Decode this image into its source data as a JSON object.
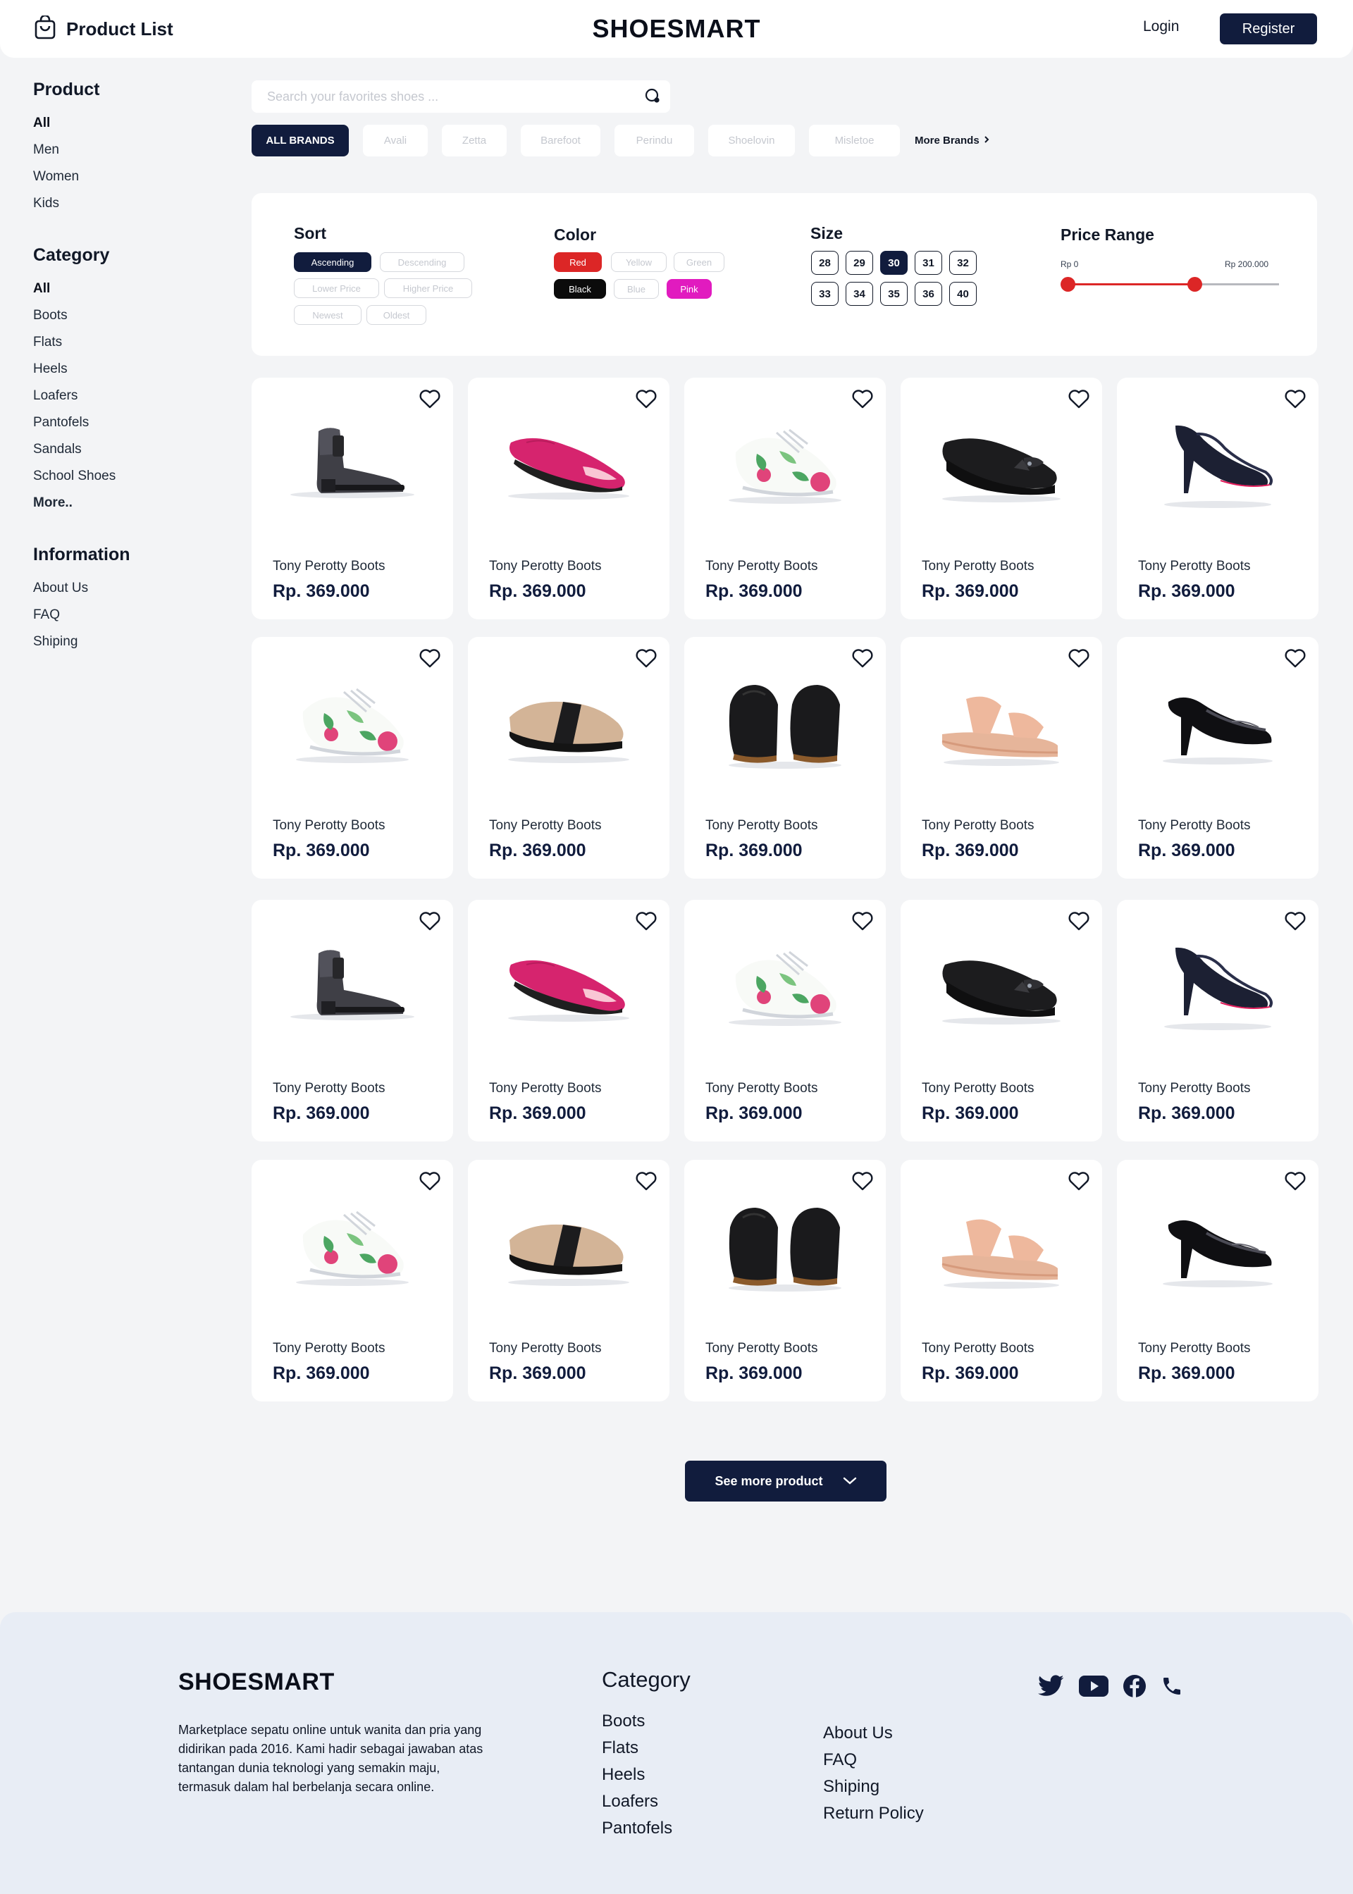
{
  "header": {
    "title": "Product List",
    "brand": "SHOESMART",
    "login_label": "Login",
    "register_label": "Register"
  },
  "sidebar": {
    "product": {
      "heading": "Product",
      "items": [
        "All",
        "Men",
        "Women",
        "Kids"
      ],
      "active": "All"
    },
    "category": {
      "heading": "Category",
      "items": [
        "All",
        "Boots",
        "Flats",
        "Heels",
        "Loafers",
        "Pantofels",
        "Sandals",
        "School Shoes"
      ],
      "more": "More..",
      "active": "All"
    },
    "information": {
      "heading": "Information",
      "items": [
        "About Us",
        "FAQ",
        "Shiping"
      ]
    }
  },
  "search": {
    "placeholder": "Search your favorites shoes ..."
  },
  "brands": {
    "items": [
      "ALL BRANDS",
      "Avali",
      "Zetta",
      "Barefoot",
      "Perindu",
      "Shoelovin",
      "Misletoe"
    ],
    "active": "ALL BRANDS",
    "more_label": "More Brands"
  },
  "filters": {
    "sort": {
      "title": "Sort",
      "options": [
        "Ascending",
        "Descending",
        "Lower Price",
        "Higher Price",
        "Newest",
        "Oldest"
      ],
      "selected": "Ascending"
    },
    "color": {
      "title": "Color",
      "options": [
        "Red",
        "Yellow",
        "Green",
        "Black",
        "Blue",
        "Pink"
      ],
      "selected": [
        "Red",
        "Black",
        "Pink"
      ],
      "swatches": {
        "Red": "#dc2626",
        "Black": "#0b0b0b",
        "Pink": "#e11bbf"
      }
    },
    "size": {
      "title": "Size",
      "options": [
        "28",
        "29",
        "30",
        "31",
        "32",
        "33",
        "34",
        "35",
        "36",
        "40"
      ],
      "selected": "30"
    },
    "price": {
      "title": "Price Range",
      "min_label": "Rp 0",
      "max_label": "Rp 200.000",
      "selected_fraction": [
        0.0,
        0.6
      ]
    }
  },
  "products": [
    {
      "name": "Tony Perotty Boots",
      "price": "Rp. 369.000",
      "shoe": "black-ankle-boot"
    },
    {
      "name": "Tony Perotty Boots",
      "price": "Rp. 369.000",
      "shoe": "pink-flat"
    },
    {
      "name": "Tony Perotty Boots",
      "price": "Rp. 369.000",
      "shoe": "floral-sneaker"
    },
    {
      "name": "Tony Perotty Boots",
      "price": "Rp. 369.000",
      "shoe": "black-wedge"
    },
    {
      "name": "Tony Perotty Boots",
      "price": "Rp. 369.000",
      "shoe": "navy-heel"
    },
    {
      "name": "Tony Perotty Boots",
      "price": "Rp. 369.000",
      "shoe": "floral-sneaker"
    },
    {
      "name": "Tony Perotty Boots",
      "price": "Rp. 369.000",
      "shoe": "beige-slipon"
    },
    {
      "name": "Tony Perotty Boots",
      "price": "Rp. 369.000",
      "shoe": "black-sandal"
    },
    {
      "name": "Tony Perotty Boots",
      "price": "Rp. 369.000",
      "shoe": "peach-wedge-sandal"
    },
    {
      "name": "Tony Perotty Boots",
      "price": "Rp. 369.000",
      "shoe": "black-patent-heel"
    },
    {
      "name": "Tony Perotty Boots",
      "price": "Rp. 369.000",
      "shoe": "black-ankle-boot"
    },
    {
      "name": "Tony Perotty Boots",
      "price": "Rp. 369.000",
      "shoe": "pink-flat"
    },
    {
      "name": "Tony Perotty Boots",
      "price": "Rp. 369.000",
      "shoe": "floral-sneaker"
    },
    {
      "name": "Tony Perotty Boots",
      "price": "Rp. 369.000",
      "shoe": "black-wedge"
    },
    {
      "name": "Tony Perotty Boots",
      "price": "Rp. 369.000",
      "shoe": "navy-heel"
    },
    {
      "name": "Tony Perotty Boots",
      "price": "Rp. 369.000",
      "shoe": "floral-sneaker"
    },
    {
      "name": "Tony Perotty Boots",
      "price": "Rp. 369.000",
      "shoe": "beige-slipon"
    },
    {
      "name": "Tony Perotty Boots",
      "price": "Rp. 369.000",
      "shoe": "black-sandal"
    },
    {
      "name": "Tony Perotty Boots",
      "price": "Rp. 369.000",
      "shoe": "peach-wedge-sandal"
    },
    {
      "name": "Tony Perotty Boots",
      "price": "Rp. 369.000",
      "shoe": "black-patent-heel"
    }
  ],
  "see_more_label": "See more product",
  "footer": {
    "brand": "SHOESMART",
    "description": "Marketplace sepatu online untuk wanita dan pria yang didirikan pada 2016. Kami hadir sebagai jawaban atas tantangan dunia teknologi yang semakin maju, termasuk dalam hal berbelanja secara online.",
    "category_title": "Category",
    "categories": [
      "Boots",
      "Flats",
      "Heels",
      "Loafers",
      "Pantofels"
    ],
    "info_links": [
      "About Us",
      "FAQ",
      "Shiping",
      "Return Policy"
    ],
    "social": [
      "twitter-icon",
      "youtube-icon",
      "facebook-icon",
      "phone-icon"
    ]
  },
  "colors": {
    "navy": "#111c3d",
    "background": "#f3f4f6",
    "footer": "#e8edf5",
    "accent_red": "#dc2626"
  }
}
